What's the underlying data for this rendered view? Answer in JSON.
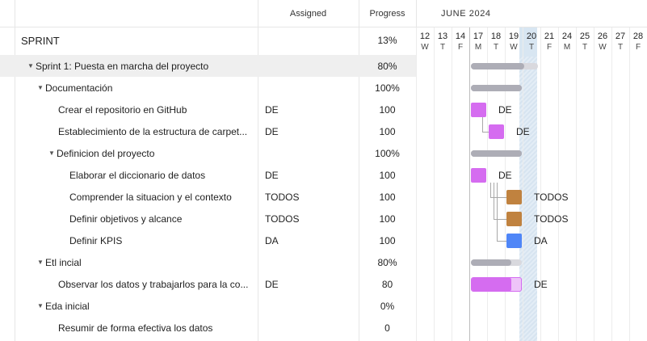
{
  "header": {
    "assigned": "Assigned",
    "progress": "Progress",
    "month": "JUNE 2024"
  },
  "sprint": {
    "title": "SPRINT",
    "progress": "13%"
  },
  "days": [
    {
      "n": "12",
      "w": "W"
    },
    {
      "n": "13",
      "w": "T"
    },
    {
      "n": "14",
      "w": "F"
    },
    {
      "n": "17",
      "w": "M"
    },
    {
      "n": "18",
      "w": "T"
    },
    {
      "n": "19",
      "w": "W"
    },
    {
      "n": "20",
      "w": "T"
    },
    {
      "n": "21",
      "w": "F"
    },
    {
      "n": "24",
      "w": "M"
    },
    {
      "n": "25",
      "w": "T"
    },
    {
      "n": "26",
      "w": "W"
    },
    {
      "n": "27",
      "w": "T"
    },
    {
      "n": "28",
      "w": "F"
    }
  ],
  "rows": [
    {
      "name": "Sprint 1: Puesta en marcha del proyecto",
      "assigned": "",
      "progress": "80%",
      "level": 1,
      "group": true
    },
    {
      "name": "Documentación",
      "assigned": "",
      "progress": "100%",
      "level": 2,
      "group": true
    },
    {
      "name": "Crear el repositorio en GitHub",
      "assigned": "DE",
      "progress": "100",
      "level": 3,
      "group": false
    },
    {
      "name": "Establecimiento de la estructura de carpet...",
      "assigned": "DE",
      "progress": "100",
      "level": 3,
      "group": false
    },
    {
      "name": "Definicion del proyecto",
      "assigned": "",
      "progress": "100%",
      "level": 3,
      "group": true
    },
    {
      "name": "Elaborar el diccionario de datos",
      "assigned": "DE",
      "progress": "100",
      "level": 4,
      "group": false
    },
    {
      "name": "Comprender la situacion y el contexto",
      "assigned": "TODOS",
      "progress": "100",
      "level": 4,
      "group": false
    },
    {
      "name": "Definir objetivos y alcance",
      "assigned": "TODOS",
      "progress": "100",
      "level": 4,
      "group": false
    },
    {
      "name": "Definir KPIS",
      "assigned": "DA",
      "progress": "100",
      "level": 4,
      "group": false
    },
    {
      "name": "Etl incial",
      "assigned": "",
      "progress": "80%",
      "level": 2,
      "group": true
    },
    {
      "name": "Observar los datos y trabajarlos para la co...",
      "assigned": "DE",
      "progress": "80",
      "level": 3,
      "group": false
    },
    {
      "name": "Eda inicial",
      "assigned": "",
      "progress": "0%",
      "level": 2,
      "group": true
    },
    {
      "name": "Resumir de forma efectiva los datos",
      "assigned": "",
      "progress": "0",
      "level": 3,
      "group": false
    }
  ],
  "bars": [
    {
      "row": 0,
      "type": "summary",
      "start": 3,
      "end": 6.9,
      "done": 0.8
    },
    {
      "row": 1,
      "type": "summary",
      "start": 3,
      "end": 6,
      "done": 1.0
    },
    {
      "row": 2,
      "type": "task",
      "start": 3,
      "end": 4,
      "done": 1.0,
      "color": "#d56cf0",
      "label": "DE"
    },
    {
      "row": 3,
      "type": "task",
      "start": 4,
      "end": 5,
      "done": 1.0,
      "color": "#d56cf0",
      "label": "DE"
    },
    {
      "row": 4,
      "type": "summary",
      "start": 3,
      "end": 6,
      "done": 1.0
    },
    {
      "row": 5,
      "type": "task",
      "start": 3,
      "end": 4,
      "done": 1.0,
      "color": "#d56cf0",
      "label": "DE"
    },
    {
      "row": 6,
      "type": "task",
      "start": 5,
      "end": 6,
      "done": 1.0,
      "color": "#c0823f",
      "label": "TODOS"
    },
    {
      "row": 7,
      "type": "task",
      "start": 5,
      "end": 6,
      "done": 1.0,
      "color": "#c0823f",
      "label": "TODOS"
    },
    {
      "row": 8,
      "type": "task",
      "start": 5,
      "end": 6,
      "done": 1.0,
      "color": "#4f86f7",
      "label": "DA"
    },
    {
      "row": 9,
      "type": "summary",
      "start": 3,
      "end": 6,
      "done": 0.8
    },
    {
      "row": 10,
      "type": "task",
      "start": 3,
      "end": 6,
      "done": 0.8,
      "color": "#d56cf0",
      "label": "DE"
    }
  ]
}
